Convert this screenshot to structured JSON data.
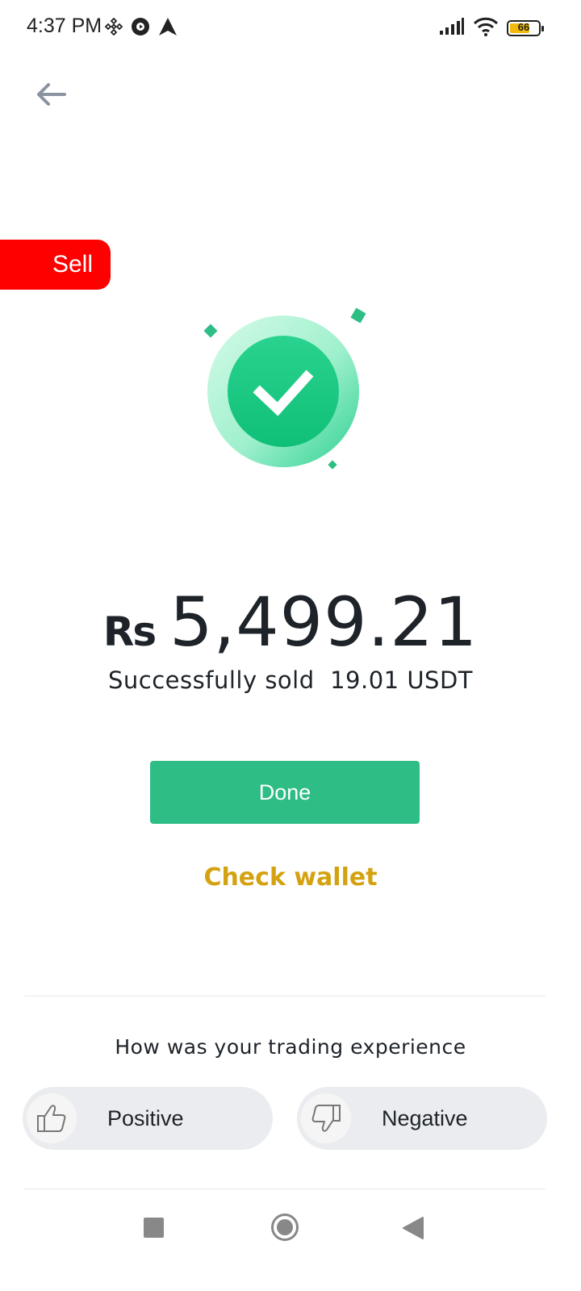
{
  "status_bar": {
    "time": "4:37 PM",
    "left_icons": [
      "binance-icon",
      "media-icon",
      "navigation-icon"
    ],
    "right_icons": [
      "signal-icon",
      "wifi-icon",
      "battery-icon"
    ],
    "battery_level": "66"
  },
  "header": {
    "back_icon": "arrow-left-icon"
  },
  "tag": {
    "label": "Sell",
    "color": "#ff0000"
  },
  "result": {
    "icon": "check-icon",
    "currency": "Rs",
    "amount": "5,499.21",
    "message": "Successfully sold  19.01 USDT"
  },
  "actions": {
    "done_label": "Done",
    "check_wallet_label": "Check wallet"
  },
  "feedback": {
    "question": "How was your trading experience",
    "positive_label": "Positive",
    "negative_label": "Negative",
    "positive_icon": "thumbs-up-icon",
    "negative_icon": "thumbs-down-icon"
  },
  "colors": {
    "accent_green": "#2ebd85",
    "wallet_gold": "#d4a211",
    "text_dark": "#1e2329"
  },
  "nav": {
    "icons": [
      "recents-icon",
      "home-icon",
      "back-icon"
    ]
  }
}
